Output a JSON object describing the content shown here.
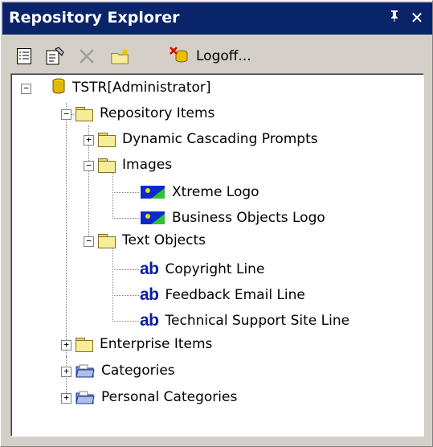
{
  "window": {
    "title": "Repository Explorer",
    "pin_glyph": "ᵖ",
    "close_glyph": "✕"
  },
  "toolbar": {
    "buttons": [
      {
        "icon": "properties-list-icon"
      },
      {
        "icon": "edit-properties-icon"
      },
      {
        "icon": "delete-x-icon",
        "disabled": true
      },
      {
        "icon": "new-folder-icon"
      }
    ],
    "logoff_label": "Logoff..."
  },
  "tree": {
    "root": {
      "label": "TSTR[Administrator]",
      "expanded": true
    },
    "repository_items": {
      "label": "Repository Items",
      "expanded": true
    },
    "dynamic_cascading_prompts": {
      "label": "Dynamic Cascading Prompts",
      "expanded": false
    },
    "images": {
      "label": "Images",
      "expanded": true
    },
    "xtreme_logo": {
      "label": "Xtreme Logo"
    },
    "business_objects_logo": {
      "label": "Business Objects Logo"
    },
    "text_objects": {
      "label": "Text Objects",
      "expanded": true
    },
    "copyright_line": {
      "label": "Copyright Line",
      "icon_text": "ab"
    },
    "feedback_email_line": {
      "label": "Feedback Email Line",
      "icon_text": "ab"
    },
    "technical_support_site_line": {
      "label": "Technical Support Site Line",
      "icon_text": "ab"
    },
    "enterprise_items": {
      "label": "Enterprise Items",
      "expanded": false
    },
    "categories": {
      "label": "Categories",
      "expanded": false
    },
    "personal_categories": {
      "label": "Personal Categories",
      "expanded": false
    },
    "expand_glyph": "+",
    "collapse_glyph": "−"
  },
  "colors": {
    "titlebar": "#0a246a",
    "text_object_icon": "#0a1f9a",
    "folder": "#f6ec9a"
  }
}
